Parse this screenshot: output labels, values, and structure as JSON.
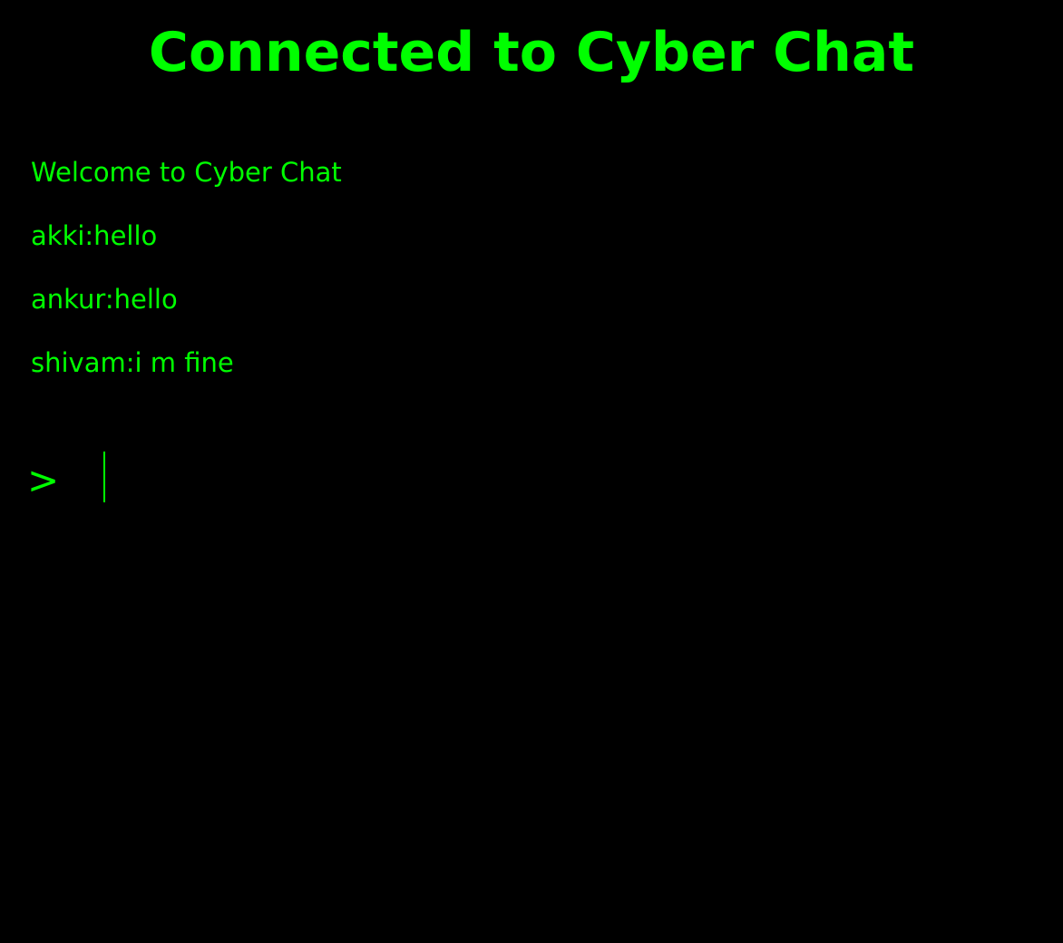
{
  "header": {
    "title": "Connected to Cyber Chat"
  },
  "messages": [
    "Welcome to Cyber Chat",
    "akki:hello",
    "ankur:hello",
    "shivam:i m fine"
  ],
  "input": {
    "prompt": ">",
    "value": "",
    "placeholder": ""
  },
  "colors": {
    "background": "#000000",
    "text": "#00ff00"
  }
}
